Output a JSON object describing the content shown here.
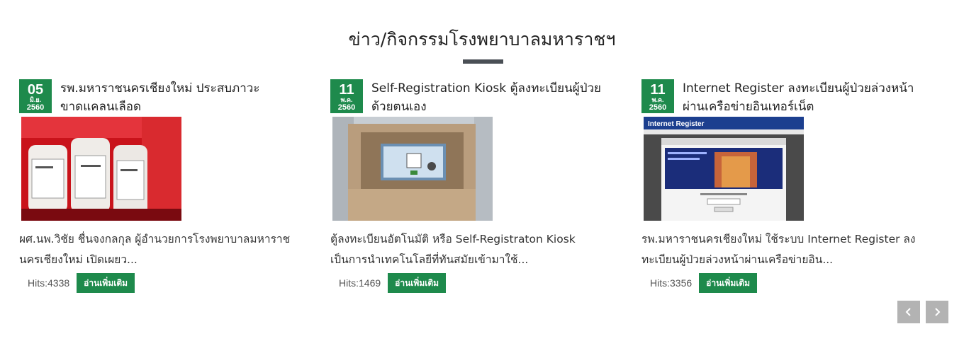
{
  "section": {
    "title": "ข่าว/กิจกรรมโรงพยาบาลมหาราชฯ"
  },
  "colors": {
    "accent": "#1e8a4c",
    "title_bar": "#4a4f55",
    "nav_button": "#b3b3b3"
  },
  "cards": [
    {
      "date": {
        "day": "05",
        "month": "มิ.ย.",
        "year": "2560"
      },
      "title": "รพ.มหาราชนครเชียงใหม่ ประสบภาวะขาดแคลนเลือด",
      "image_subject": "blood-bags-photo",
      "excerpt": "ผศ.นพ.วิชัย ชื่นจงกลกุล ผู้อำนวยการโรงพยาบาลมหาราชนครเชียงใหม่ เปิดเผยว...",
      "hits": "Hits:4338",
      "read_more": "อ่านเพิ่มเติม"
    },
    {
      "date": {
        "day": "11",
        "month": "พ.ค.",
        "year": "2560"
      },
      "title": "Self-Registration Kiosk ตู้ลงทะเบียนผู้ป่วยด้วยตนเอง",
      "image_subject": "kiosk-photo",
      "excerpt": "ตู้ลงทะเบียนอัตโนมัติ หรือ Self-Registraton Kiosk เป็นการนำเทคโนโลยีที่ทันสมัยเข้ามาใช้...",
      "hits": "Hits:1469",
      "read_more": "อ่านเพิ่มเติม"
    },
    {
      "date": {
        "day": "11",
        "month": "พ.ค.",
        "year": "2560"
      },
      "title": "Internet Register ลงทะเบียนผู้ป่วยล่วงหน้าผ่านเครือข่ายอินเทอร์เน็ต",
      "image_subject": "website-screenshot",
      "image_banner_text": "Internet Register",
      "excerpt": "รพ.มหาราชนครเชียงใหม่ ใช้ระบบ Internet Register ลงทะเบียนผู้ป่วยล่วงหน้าผ่านเครือข่ายอิน...",
      "hits": "Hits:3356",
      "read_more": "อ่านเพิ่มเติม"
    }
  ],
  "carousel": {
    "prev_icon": "chevron-left-icon",
    "next_icon": "chevron-right-icon"
  }
}
